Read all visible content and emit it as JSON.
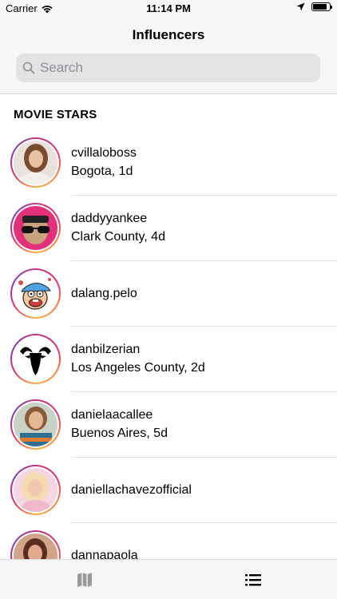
{
  "status_bar": {
    "carrier": "Carrier",
    "time": "11:14 PM",
    "battery_level": 0.85
  },
  "nav": {
    "title": "Influencers",
    "search": {
      "placeholder": "Search",
      "value": ""
    }
  },
  "section": {
    "title": "MOVIE STARS"
  },
  "influencers": [
    {
      "username": "cvillaloboss",
      "subtitle": "Bogota, 1d",
      "icon": "avatar-photo"
    },
    {
      "username": "daddyyankee",
      "subtitle": "Clark County, 4d",
      "icon": "avatar-photo"
    },
    {
      "username": "dalang.pelo",
      "subtitle": "",
      "icon": "avatar-cartoon"
    },
    {
      "username": "danbilzerian",
      "subtitle": "Los Angeles County, 2d",
      "icon": "avatar-goat-logo"
    },
    {
      "username": "danielaacallee",
      "subtitle": "Buenos Aires, 5d",
      "icon": "avatar-photo"
    },
    {
      "username": "daniellachavezofficial",
      "subtitle": "",
      "icon": "avatar-photo"
    },
    {
      "username": "dannapaola",
      "subtitle": "",
      "icon": "avatar-photo"
    }
  ],
  "tab_bar": {
    "tabs": [
      {
        "name": "map",
        "icon": "map-icon",
        "selected": false
      },
      {
        "name": "list",
        "icon": "list-icon",
        "selected": true
      }
    ]
  },
  "colors": {
    "bar_background": "#f7f7f7",
    "search_field": "#e3e3e5",
    "placeholder": "#8e8e93",
    "ring_gradient": [
      "#c13584",
      "#e1306c",
      "#fd7f3d",
      "#fcb045",
      "#833ab4"
    ]
  }
}
